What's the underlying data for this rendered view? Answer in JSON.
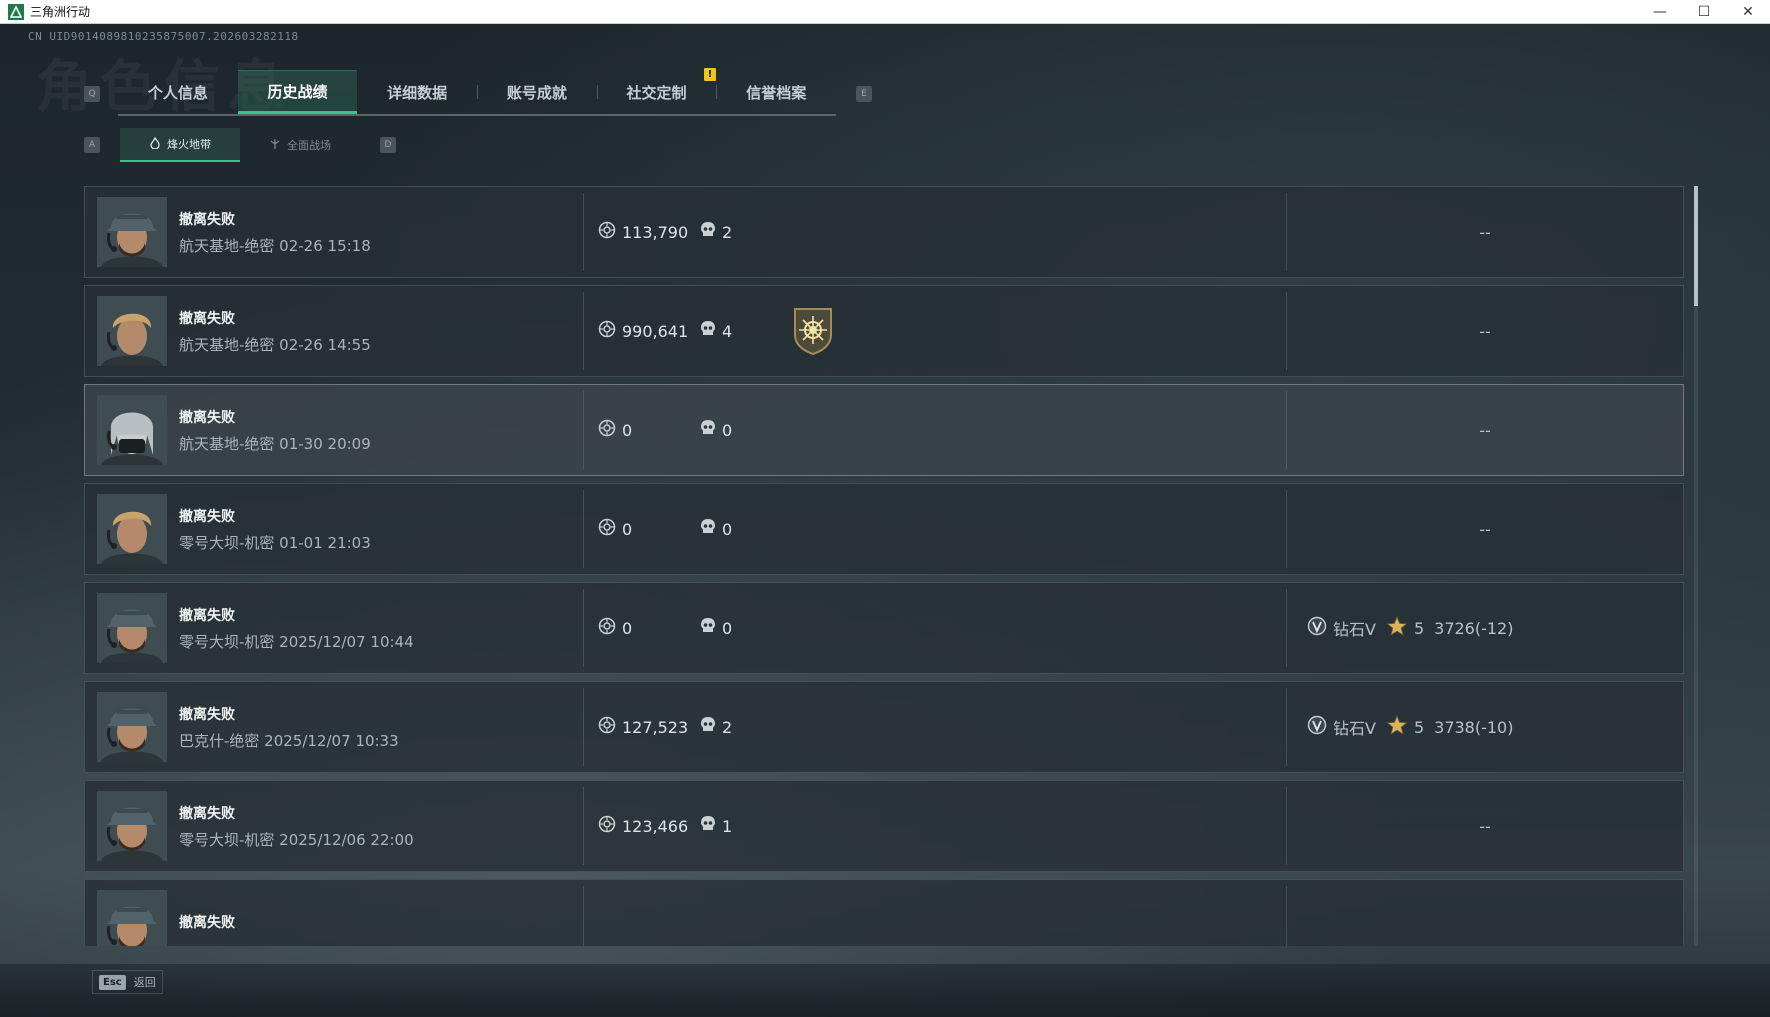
{
  "window": {
    "title": "三角洲行动",
    "controls": {
      "minimize": "—",
      "maximize": "☐",
      "close": "✕"
    }
  },
  "uid": "CN UID9014089810235875007.202603282118",
  "nav": {
    "left_key": "Q",
    "right_key": "E",
    "tabs": [
      "个人信息",
      "历史战绩",
      "详细数据",
      "账号成就",
      "社交定制",
      "信誉档案"
    ],
    "active_tab": "历史战绩",
    "notification": "!"
  },
  "subnav": {
    "left_key": "A",
    "right_key": "D",
    "tabs": [
      {
        "label": "烽火地带",
        "icon": "flame-mode-icon",
        "active": true
      },
      {
        "label": "全面战场",
        "icon": "warfare-mode-icon",
        "active": false
      }
    ]
  },
  "records": [
    {
      "result": "撤离失败",
      "map_time": "航天基地-绝密 02-26 15:18",
      "money": "113,790",
      "kills": "2",
      "medal": false,
      "rank": "--",
      "avatar": "cap-soldier"
    },
    {
      "result": "撤离失败",
      "map_time": "航天基地-绝密 02-26 14:55",
      "money": "990,641",
      "kills": "4",
      "medal": true,
      "rank": "--",
      "avatar": "blond-soldier"
    },
    {
      "result": "撤离失败",
      "map_time": "航天基地-绝密 01-30 20:09",
      "money": "0",
      "kills": "0",
      "medal": false,
      "rank": "--",
      "avatar": "masked-soldier",
      "highlight": true
    },
    {
      "result": "撤离失败",
      "map_time": "零号大坝-机密 01-01 21:03",
      "money": "0",
      "kills": "0",
      "medal": false,
      "rank": "--",
      "avatar": "blond-soldier"
    },
    {
      "result": "撤离失败",
      "map_time": "零号大坝-机密 2025/12/07 10:44",
      "money": "0",
      "kills": "0",
      "medal": false,
      "rank": null,
      "tier": "钻石V",
      "stars": "5",
      "score": "3726(-12)",
      "avatar": "cap-soldier"
    },
    {
      "result": "撤离失败",
      "map_time": "巴克什-绝密 2025/12/07 10:33",
      "money": "127,523",
      "kills": "2",
      "medal": false,
      "rank": null,
      "tier": "钻石V",
      "stars": "5",
      "score": "3738(-10)",
      "avatar": "cap-soldier"
    },
    {
      "result": "撤离失败",
      "map_time": "零号大坝-机密 2025/12/06 22:00",
      "money": "123,466",
      "kills": "1",
      "medal": false,
      "rank": "--",
      "avatar": "cap-soldier"
    },
    {
      "result": "撤离失败",
      "map_time": "",
      "money": "",
      "kills": "",
      "medal": false,
      "rank": "",
      "avatar": "cap-soldier"
    }
  ],
  "footer": {
    "key": "Esc",
    "label": "返回"
  },
  "colors": {
    "accent": "#34c58a",
    "notice": "#f0c419",
    "rank_star": "#d7b45a"
  }
}
